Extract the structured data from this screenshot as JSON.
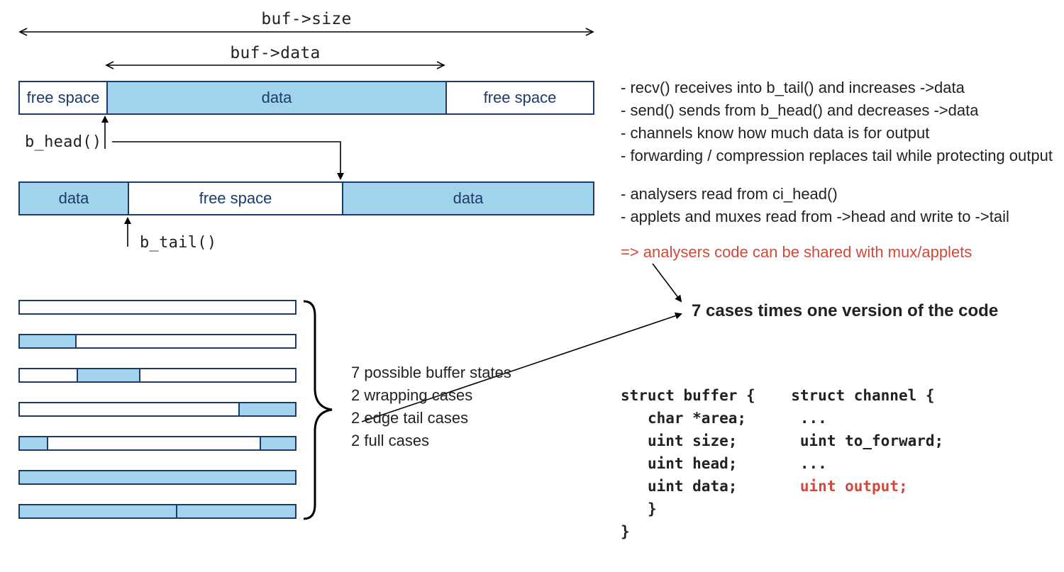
{
  "top_arrows": {
    "size_label": "buf->size",
    "data_label": "buf->data"
  },
  "bar1": {
    "left": "free space",
    "mid": "data",
    "right": "free space"
  },
  "labels": {
    "b_head": "b_head()",
    "b_tail": "b_tail()"
  },
  "bar2": {
    "left": "data",
    "mid": "free space",
    "right": "data"
  },
  "states_caption": {
    "l1": "7 possible buffer states",
    "l2": "2 wrapping cases",
    "l3": "2 edge tail cases",
    "l4": "2 full cases"
  },
  "bullets_top": [
    "- recv() receives into b_tail() and increases ->data",
    "- send() sends from b_head() and decreases ->data",
    "- channels know how much data is for output",
    "- forwarding / compression replaces tail while protecting output"
  ],
  "bullets_mid": [
    "- analysers read from ci_head()",
    "- applets and muxes read from ->head and write to ->tail"
  ],
  "conclusion": "=> analysers code can be shared with mux/applets",
  "headline": "7 cases times one version of the code",
  "code": {
    "struct_buffer": {
      "open": "struct buffer {",
      "area": "char *area;",
      "size": "uint size;",
      "head": "uint head;",
      "data": "uint data;",
      "close": "}",
      "close2": "}"
    },
    "struct_channel": {
      "open": "struct channel {",
      "dots1": "...",
      "tofwd": "uint to_forward;",
      "dots2": "...",
      "output": "uint output;"
    }
  }
}
